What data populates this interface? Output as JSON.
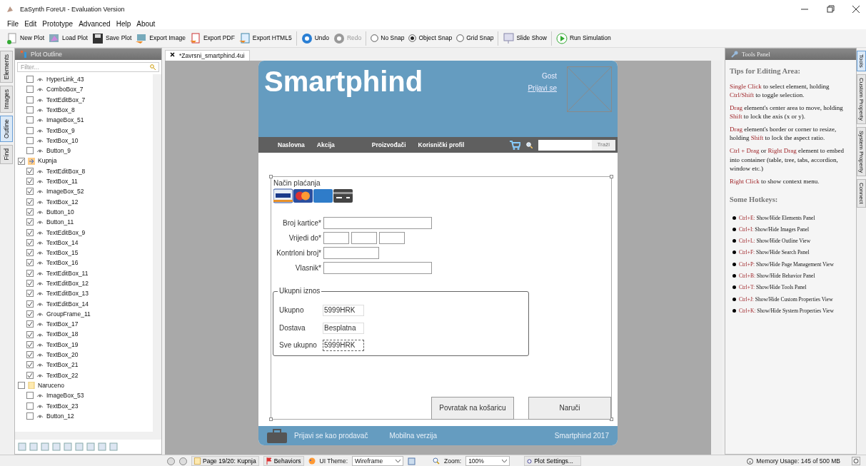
{
  "window": {
    "title": "EaSynth ForeUI - Evaluation Version"
  },
  "menu": [
    "File",
    "Edit",
    "Prototype",
    "Advanced",
    "Help",
    "About"
  ],
  "toolbar": [
    {
      "label": "New Plot",
      "disabled": false
    },
    {
      "label": "Load Plot",
      "disabled": false
    },
    {
      "label": "Save Plot",
      "disabled": false
    },
    {
      "label": "Export Image",
      "disabled": false
    },
    {
      "label": "Export PDF",
      "disabled": false
    },
    {
      "label": "Export HTML5",
      "disabled": false
    },
    {
      "label": "Undo",
      "disabled": false
    },
    {
      "label": "Redo",
      "disabled": true
    }
  ],
  "snap": [
    {
      "label": "No Snap",
      "selected": false
    },
    {
      "label": "Object Snap",
      "selected": true
    },
    {
      "label": "Grid Snap",
      "selected": false
    }
  ],
  "toolbar_end": [
    {
      "label": "Slide Show"
    },
    {
      "label": "Run Simulation"
    }
  ],
  "left_tabs": [
    {
      "label": "Elements",
      "selected": false
    },
    {
      "label": "Images",
      "selected": false
    },
    {
      "label": "Outline",
      "selected": true
    },
    {
      "label": "Find",
      "selected": false
    }
  ],
  "outline": {
    "title": "Plot Outline",
    "filter_placeholder": "Filter...",
    "tree": [
      {
        "children": [
          {
            "label": "HyperLink_43",
            "checked": false
          },
          {
            "label": "ComboBox_7",
            "checked": false
          },
          {
            "label": "TextEditBox_7",
            "checked": false
          },
          {
            "label": "TextBox_8",
            "checked": false
          },
          {
            "label": "ImageBox_51",
            "checked": false
          },
          {
            "label": "TextBox_9",
            "checked": false
          },
          {
            "label": "TextBox_10",
            "checked": false
          },
          {
            "label": "Button_9",
            "checked": false
          }
        ]
      },
      {
        "label": "Kupnja",
        "checked": true,
        "current": true,
        "children": [
          {
            "label": "TextEditBox_8",
            "checked": true
          },
          {
            "label": "TextBox_11",
            "checked": true
          },
          {
            "label": "ImageBox_52",
            "checked": true
          },
          {
            "label": "TextBox_12",
            "checked": true
          },
          {
            "label": "Button_10",
            "checked": true
          },
          {
            "label": "Button_11",
            "checked": true
          },
          {
            "label": "TextEditBox_9",
            "checked": true
          },
          {
            "label": "TextBox_14",
            "checked": true
          },
          {
            "label": "TextBox_15",
            "checked": true
          },
          {
            "label": "TextBox_16",
            "checked": true
          },
          {
            "label": "TextEditBox_11",
            "checked": true
          },
          {
            "label": "TextEditBox_12",
            "checked": true
          },
          {
            "label": "TextEditBox_13",
            "checked": true
          },
          {
            "label": "TextEditBox_14",
            "checked": true
          },
          {
            "label": "GroupFrame_11",
            "checked": true
          },
          {
            "label": "TextBox_17",
            "checked": true
          },
          {
            "label": "TextBox_18",
            "checked": true
          },
          {
            "label": "TextBox_19",
            "checked": true
          },
          {
            "label": "TextBox_20",
            "checked": true
          },
          {
            "label": "TextBox_21",
            "checked": true
          },
          {
            "label": "TextBox_22",
            "checked": true
          }
        ]
      },
      {
        "label": "Naruceno",
        "checked": false,
        "current": false,
        "children": [
          {
            "label": "ImageBox_53",
            "checked": false
          },
          {
            "label": "TextBox_23",
            "checked": false
          },
          {
            "label": "Button_12",
            "checked": false
          }
        ]
      }
    ]
  },
  "doc_tab": {
    "label": "*Zavrsni_smartphind.4ui"
  },
  "mockup": {
    "brand": "Smartphind",
    "user": "Gost",
    "login_link": "Prijavi se",
    "nav": [
      "Naslovna",
      "Akcija",
      "Proizvođači",
      "Korisnički profil"
    ],
    "search_button": "Traži",
    "payment_label": "Način plaćanja",
    "fields": [
      {
        "label": "Broj kartice*",
        "kind": "long"
      },
      {
        "label": "Vrijedi do*",
        "kind": "date"
      },
      {
        "label": "Kontrloni broj*",
        "kind": "short"
      },
      {
        "label": "Vlasnik*",
        "kind": "long"
      }
    ],
    "totals": {
      "title": "Ukupni iznos",
      "rows": [
        {
          "label": "Ukupno",
          "value": "5999HRK",
          "selected": false
        },
        {
          "label": "Dostava",
          "value": "Besplatna",
          "selected": false
        },
        {
          "label": "Sve ukupno",
          "value": "5999HRK",
          "selected": true
        }
      ]
    },
    "buttons": [
      "Povratak na košaricu",
      "Naruči"
    ],
    "footer": {
      "seller_link": "Prijavi se kao prodavač",
      "mobile": "Mobilna verzija",
      "copyright": "Smartphind 2017"
    }
  },
  "tools_panel": {
    "title": "Tools Panel",
    "heading": "Tips for Editing Area:",
    "tips": [
      [
        {
          "t": "Single Click",
          "hl": true
        },
        {
          "t": " to select element, holding ",
          "hl": false
        },
        {
          "t": "Ctrl/Shift",
          "hl": true
        },
        {
          "t": " to toggle selection.",
          "hl": false
        }
      ],
      [
        {
          "t": "Drag",
          "hl": true
        },
        {
          "t": " element's center area to move, holding ",
          "hl": false
        },
        {
          "t": "Shift",
          "hl": true
        },
        {
          "t": " to lock the axis (x or y).",
          "hl": false
        }
      ],
      [
        {
          "t": "Drag",
          "hl": true
        },
        {
          "t": " element's border or corner to resize, holding ",
          "hl": false
        },
        {
          "t": "Shift",
          "hl": true
        },
        {
          "t": " to lock the aspect ratio.",
          "hl": false
        }
      ],
      [
        {
          "t": "Ctrl + Drag",
          "hl": true
        },
        {
          "t": " or ",
          "hl": false
        },
        {
          "t": "Right Drag",
          "hl": true
        },
        {
          "t": " element to embed into container (table, tree, tabs, accordion, window etc.)",
          "hl": false
        }
      ],
      [
        {
          "t": "Right Click",
          "hl": true
        },
        {
          "t": " to show context menu.",
          "hl": false
        }
      ]
    ],
    "hotkeys_heading": "Some Hotkeys:",
    "hotkeys": [
      {
        "key": "Ctrl+E:",
        "text": " Show/Hide Elements Panel"
      },
      {
        "key": "Ctrl+I:",
        "text": " Show/Hide Images Panel"
      },
      {
        "key": "Ctrl+L:",
        "text": " Show/Hide Outline View"
      },
      {
        "key": "Ctrl+F:",
        "text": " Show/Hide Search Panel"
      },
      {
        "key": "Ctrl+P:",
        "text": " Show/Hide Page Management View"
      },
      {
        "key": "Ctrl+B:",
        "text": " Show/Hide Behavior Panel"
      },
      {
        "key": "Ctrl+T:",
        "text": " Show/Hide Tools Panel"
      },
      {
        "key": "Ctrl+J:",
        "text": " Show/Hide Custom Properties View"
      },
      {
        "key": "Ctrl+K:",
        "text": " Show/Hide System Properties View"
      }
    ]
  },
  "right_tabs": [
    {
      "label": "Tools",
      "selected": true
    },
    {
      "label": "Custom Property",
      "selected": false
    },
    {
      "label": "System Property",
      "selected": false
    },
    {
      "label": "Connect",
      "selected": false
    }
  ],
  "status_bar": {
    "page": "Page 19/20: Kupnja",
    "behaviors": "Behaviors",
    "theme_label": "UI Theme:",
    "theme": "Wireframe",
    "zoom_label": "Zoom:",
    "zoom": "100%",
    "plot_settings": "Plot Settings...",
    "memory": "Memory Usage: 145 of  500 MB"
  }
}
